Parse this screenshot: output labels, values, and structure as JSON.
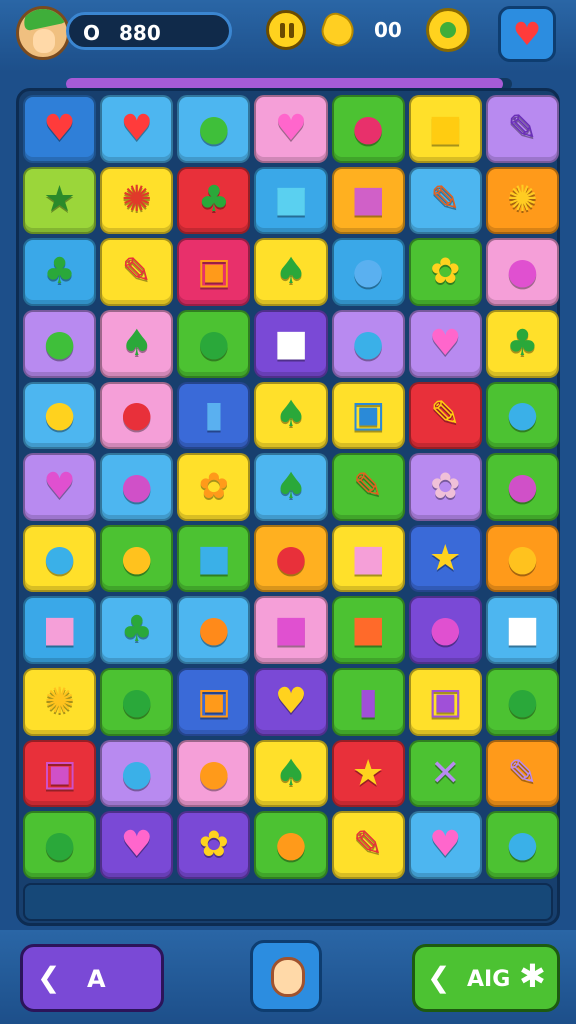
{
  "header": {
    "score_prefix": "O",
    "score_value": "880",
    "coins_value": "00",
    "progress_fraction": 0.98
  },
  "icons": {
    "avatar": "player-avatar-icon",
    "pause": "pause-icon",
    "coin": "coin-icon",
    "badge": "badge-icon",
    "heart": "heart-icon"
  },
  "board": {
    "rows": [
      [
        {
          "color": "#2f7fd8",
          "glyph": "♥",
          "fg": "#ff3b3b",
          "name": "heart"
        },
        {
          "color": "#4db6f0",
          "glyph": "♥",
          "fg": "#ff3b3b",
          "name": "heart"
        },
        {
          "color": "#4db6f0",
          "glyph": "●",
          "fg": "#3fbf3a",
          "name": "gem"
        },
        {
          "color": "#f59fd8",
          "glyph": "♥",
          "fg": "#ff66cc",
          "name": "heart"
        },
        {
          "color": "#4cc232",
          "glyph": "●",
          "fg": "#e8306b",
          "name": "berry"
        },
        {
          "color": "#ffe02a",
          "glyph": "■",
          "fg": "#ffcc11",
          "name": "toast"
        },
        {
          "color": "#b88af0",
          "glyph": "✎",
          "fg": "#6a2fb8",
          "name": "pencil"
        }
      ],
      [
        {
          "color": "#9bd63a",
          "glyph": "★",
          "fg": "#2a8a2a",
          "name": "star"
        },
        {
          "color": "#ffe02a",
          "glyph": "✺",
          "fg": "#e03a2a",
          "name": "flower"
        },
        {
          "color": "#e8303a",
          "glyph": "♣",
          "fg": "#2aa83a",
          "name": "leaf"
        },
        {
          "color": "#3aa8e8",
          "glyph": "■",
          "fg": "#5ad0f0",
          "name": "block"
        },
        {
          "color": "#ffb020",
          "glyph": "■",
          "fg": "#d060c8",
          "name": "block"
        },
        {
          "color": "#4db6f0",
          "glyph": "✎",
          "fg": "#e06020",
          "name": "pencil"
        },
        {
          "color": "#ff9a1a",
          "glyph": "✺",
          "fg": "#ffcc22",
          "name": "spiral"
        }
      ],
      [
        {
          "color": "#3aa8e8",
          "glyph": "♣",
          "fg": "#2aa83a",
          "name": "leaf"
        },
        {
          "color": "#ffe02a",
          "glyph": "✎",
          "fg": "#e8303a",
          "name": "pencil"
        },
        {
          "color": "#e8306b",
          "glyph": "▣",
          "fg": "#ff9a1a",
          "name": "frame"
        },
        {
          "color": "#ffe02a",
          "glyph": "♠",
          "fg": "#2aa83a",
          "name": "leaf"
        },
        {
          "color": "#3aa8e8",
          "glyph": "●",
          "fg": "#5ab0f0",
          "name": "gem"
        },
        {
          "color": "#4cc232",
          "glyph": "✿",
          "fg": "#ffd21e",
          "name": "flower"
        },
        {
          "color": "#f59fd8",
          "glyph": "●",
          "fg": "#e050d0",
          "name": "blob"
        }
      ],
      [
        {
          "color": "#b88af0",
          "glyph": "●",
          "fg": "#3fbf3a",
          "name": "apple"
        },
        {
          "color": "#f59fd8",
          "glyph": "♠",
          "fg": "#2aa83a",
          "name": "leaf"
        },
        {
          "color": "#4cc232",
          "glyph": "●",
          "fg": "#2aa83a",
          "name": "apple"
        },
        {
          "color": "#7a49d6",
          "glyph": "■",
          "fg": "#ffffff",
          "name": "cloud"
        },
        {
          "color": "#b88af0",
          "glyph": "●",
          "fg": "#3ab0e8",
          "name": "gem"
        },
        {
          "color": "#b88af0",
          "glyph": "♥",
          "fg": "#ff66cc",
          "name": "heart"
        },
        {
          "color": "#ffe02a",
          "glyph": "♣",
          "fg": "#2aa83a",
          "name": "leaf"
        }
      ],
      [
        {
          "color": "#4db6f0",
          "glyph": "●",
          "fg": "#ffd21e",
          "name": "smiley"
        },
        {
          "color": "#f59fd8",
          "glyph": "●",
          "fg": "#e8303a",
          "name": "blob"
        },
        {
          "color": "#3a6ad8",
          "glyph": "▮",
          "fg": "#5ab0f0",
          "name": "battery"
        },
        {
          "color": "#ffe02a",
          "glyph": "♠",
          "fg": "#2aa83a",
          "name": "leaf"
        },
        {
          "color": "#ffe02a",
          "glyph": "▣",
          "fg": "#2a8ad8",
          "name": "screen"
        },
        {
          "color": "#e8303a",
          "glyph": "✎",
          "fg": "#ffcc11",
          "name": "pencil"
        },
        {
          "color": "#4cc232",
          "glyph": "●",
          "fg": "#3ab0e8",
          "name": "blob"
        }
      ],
      [
        {
          "color": "#b88af0",
          "glyph": "♥",
          "fg": "#e050d0",
          "name": "heart"
        },
        {
          "color": "#4db6f0",
          "glyph": "●",
          "fg": "#d050c8",
          "name": "berry"
        },
        {
          "color": "#ffe02a",
          "glyph": "✿",
          "fg": "#ff9a1a",
          "name": "blob"
        },
        {
          "color": "#4db6f0",
          "glyph": "♠",
          "fg": "#2aa83a",
          "name": "leaf"
        },
        {
          "color": "#4cc232",
          "glyph": "✎",
          "fg": "#e06020",
          "name": "pencil"
        },
        {
          "color": "#b88af0",
          "glyph": "✿",
          "fg": "#f0c0d8",
          "name": "cloud"
        },
        {
          "color": "#4cc232",
          "glyph": "●",
          "fg": "#d050c8",
          "name": "berry"
        }
      ],
      [
        {
          "color": "#ffe02a",
          "glyph": "●",
          "fg": "#3ab0e8",
          "name": "blob"
        },
        {
          "color": "#4cc232",
          "glyph": "●",
          "fg": "#ffc21e",
          "name": "apple"
        },
        {
          "color": "#4cc232",
          "glyph": "■",
          "fg": "#3ab0e8",
          "name": "block"
        },
        {
          "color": "#ffb020",
          "glyph": "●",
          "fg": "#e8303a",
          "name": "blob"
        },
        {
          "color": "#ffe02a",
          "glyph": "■",
          "fg": "#f59fd8",
          "name": "toast"
        },
        {
          "color": "#3a6ad8",
          "glyph": "★",
          "fg": "#ffd21e",
          "name": "star"
        },
        {
          "color": "#ff9a1a",
          "glyph": "●",
          "fg": "#ffc21e",
          "name": "blob"
        }
      ],
      [
        {
          "color": "#3aa8e8",
          "glyph": "■",
          "fg": "#f59fd8",
          "name": "block"
        },
        {
          "color": "#4db6f0",
          "glyph": "♣",
          "fg": "#2aa83a",
          "name": "leaf"
        },
        {
          "color": "#4db6f0",
          "glyph": "●",
          "fg": "#ff8a1a",
          "name": "acorn"
        },
        {
          "color": "#f59fd8",
          "glyph": "■",
          "fg": "#e050d0",
          "name": "block"
        },
        {
          "color": "#4cc232",
          "glyph": "■",
          "fg": "#ff6a2a",
          "name": "block"
        },
        {
          "color": "#7a49d6",
          "glyph": "●",
          "fg": "#e050d0",
          "name": "blob"
        },
        {
          "color": "#4db6f0",
          "glyph": "■",
          "fg": "#ffffff",
          "name": "cloud"
        }
      ],
      [
        {
          "color": "#ffe02a",
          "glyph": "✺",
          "fg": "#ffc21e",
          "name": "sun"
        },
        {
          "color": "#4cc232",
          "glyph": "●",
          "fg": "#2aa83a",
          "name": "gem"
        },
        {
          "color": "#3a6ad8",
          "glyph": "▣",
          "fg": "#ff9a1a",
          "name": "frame"
        },
        {
          "color": "#7a49d6",
          "glyph": "♥",
          "fg": "#ffd21e",
          "name": "heart"
        },
        {
          "color": "#4cc232",
          "glyph": "▮",
          "fg": "#a050d8",
          "name": "battery"
        },
        {
          "color": "#ffe02a",
          "glyph": "▣",
          "fg": "#a050d8",
          "name": "tablet"
        },
        {
          "color": "#4cc232",
          "glyph": "●",
          "fg": "#2aa83a",
          "name": "apple"
        }
      ],
      [
        {
          "color": "#e8303a",
          "glyph": "▣",
          "fg": "#d050c8",
          "name": "frame"
        },
        {
          "color": "#b88af0",
          "glyph": "●",
          "fg": "#3ab0e8",
          "name": "gem"
        },
        {
          "color": "#f59fd8",
          "glyph": "●",
          "fg": "#ff9a1a",
          "name": "blob"
        },
        {
          "color": "#ffe02a",
          "glyph": "♠",
          "fg": "#2aa83a",
          "name": "leaf"
        },
        {
          "color": "#e8303a",
          "glyph": "★",
          "fg": "#ffd21e",
          "name": "star"
        },
        {
          "color": "#4cc232",
          "glyph": "✕",
          "fg": "#b88af0",
          "name": "crossed-pencils"
        },
        {
          "color": "#ff9a1a",
          "glyph": "✎",
          "fg": "#b88af0",
          "name": "pencil"
        }
      ],
      [
        {
          "color": "#4cc232",
          "glyph": "●",
          "fg": "#2aa83a",
          "name": "leaf"
        },
        {
          "color": "#7a49d6",
          "glyph": "♥",
          "fg": "#ff66cc",
          "name": "heart"
        },
        {
          "color": "#7a49d6",
          "glyph": "✿",
          "fg": "#ffd21e",
          "name": "cloud"
        },
        {
          "color": "#4cc232",
          "glyph": "●",
          "fg": "#ff9a1a",
          "name": "blob"
        },
        {
          "color": "#ffe02a",
          "glyph": "✎",
          "fg": "#e8303a",
          "name": "pencil"
        },
        {
          "color": "#4db6f0",
          "glyph": "♥",
          "fg": "#ff66cc",
          "name": "heart"
        },
        {
          "color": "#4cc232",
          "glyph": "●",
          "fg": "#3ab0e8",
          "name": "blob"
        }
      ]
    ]
  },
  "footer": {
    "left_button_arrow": "❮",
    "left_button_label": "A",
    "right_button_arrow": "❮",
    "right_button_label": "AIG",
    "right_button_star": "✱"
  }
}
